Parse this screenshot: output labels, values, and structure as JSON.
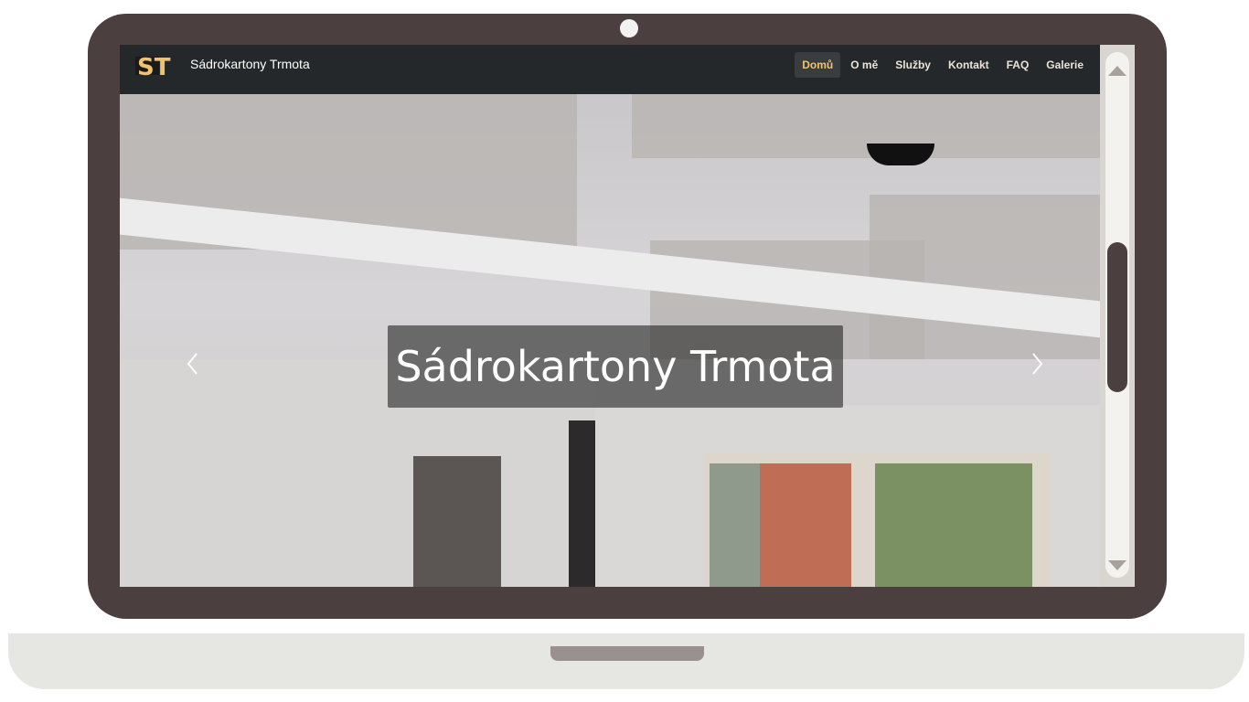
{
  "brand": {
    "logo_text": "ST",
    "name": "Sádrokartony Trmota"
  },
  "nav": {
    "items": [
      {
        "label": "Domů",
        "active": true
      },
      {
        "label": "O mě",
        "active": false
      },
      {
        "label": "Služby",
        "active": false
      },
      {
        "label": "Kontakt",
        "active": false
      },
      {
        "label": "FAQ",
        "active": false
      },
      {
        "label": "Galerie",
        "active": false
      }
    ]
  },
  "hero": {
    "caption": "Sádrokartony Trmota",
    "prev_icon": "chevron-left-icon",
    "next_icon": "chevron-right-icon"
  },
  "colors": {
    "frame": "#4b3f40",
    "navbar": "#24282b",
    "active_link": "#f0c36b",
    "logo_accent": "#f0c36b"
  }
}
